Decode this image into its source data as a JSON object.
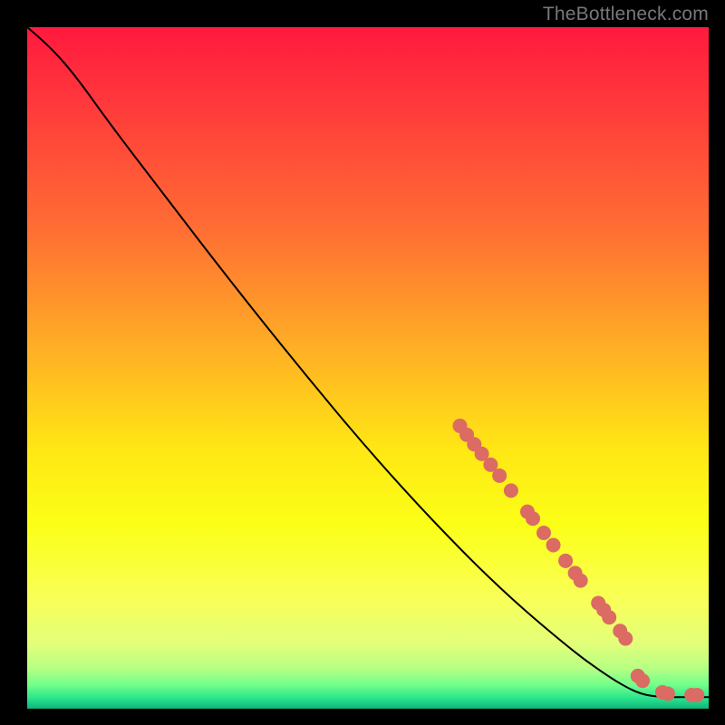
{
  "watermark": "TheBottleneck.com",
  "chart_data": {
    "type": "line",
    "title": "",
    "xlabel": "",
    "ylabel": "",
    "xlim": [
      0,
      100
    ],
    "ylim": [
      0,
      100
    ],
    "background_gradient": {
      "stops": [
        {
          "offset": 0.0,
          "color": "#ff193e"
        },
        {
          "offset": 0.12,
          "color": "#ff3b3b"
        },
        {
          "offset": 0.3,
          "color": "#ff6f33"
        },
        {
          "offset": 0.48,
          "color": "#ffb224"
        },
        {
          "offset": 0.62,
          "color": "#ffe714"
        },
        {
          "offset": 0.73,
          "color": "#fbff17"
        },
        {
          "offset": 0.84,
          "color": "#f9ff58"
        },
        {
          "offset": 0.905,
          "color": "#e2ff7a"
        },
        {
          "offset": 0.94,
          "color": "#b8ff83"
        },
        {
          "offset": 0.965,
          "color": "#72ff8b"
        },
        {
          "offset": 0.985,
          "color": "#29e48c"
        },
        {
          "offset": 1.0,
          "color": "#0fb37a"
        }
      ]
    },
    "series": [
      {
        "name": "curve",
        "color": "#000000",
        "width": 2,
        "points": [
          {
            "x": 0.0,
            "y": 100.0
          },
          {
            "x": 3.0,
            "y": 97.5
          },
          {
            "x": 7.0,
            "y": 93.0
          },
          {
            "x": 12.0,
            "y": 86.0
          },
          {
            "x": 20.0,
            "y": 75.5
          },
          {
            "x": 30.0,
            "y": 62.5
          },
          {
            "x": 40.0,
            "y": 50.0
          },
          {
            "x": 50.0,
            "y": 38.0
          },
          {
            "x": 60.0,
            "y": 27.0
          },
          {
            "x": 70.0,
            "y": 17.0
          },
          {
            "x": 80.0,
            "y": 8.5
          },
          {
            "x": 85.0,
            "y": 4.9
          },
          {
            "x": 88.0,
            "y": 3.1
          },
          {
            "x": 90.0,
            "y": 2.2
          },
          {
            "x": 92.0,
            "y": 1.8
          },
          {
            "x": 94.0,
            "y": 1.7
          },
          {
            "x": 97.0,
            "y": 1.7
          },
          {
            "x": 100.0,
            "y": 1.7
          }
        ]
      }
    ],
    "markers": {
      "name": "data-points",
      "color": "#db6b63",
      "radius": 8,
      "points": [
        {
          "x": 63.5,
          "y": 41.5
        },
        {
          "x": 64.5,
          "y": 40.2
        },
        {
          "x": 65.6,
          "y": 38.8
        },
        {
          "x": 66.7,
          "y": 37.4
        },
        {
          "x": 68.0,
          "y": 35.8
        },
        {
          "x": 69.3,
          "y": 34.2
        },
        {
          "x": 71.0,
          "y": 32.0
        },
        {
          "x": 73.4,
          "y": 28.9
        },
        {
          "x": 74.2,
          "y": 27.9
        },
        {
          "x": 75.8,
          "y": 25.8
        },
        {
          "x": 77.2,
          "y": 24.0
        },
        {
          "x": 79.0,
          "y": 21.7
        },
        {
          "x": 80.4,
          "y": 19.9
        },
        {
          "x": 81.2,
          "y": 18.8
        },
        {
          "x": 83.8,
          "y": 15.5
        },
        {
          "x": 84.6,
          "y": 14.5
        },
        {
          "x": 85.4,
          "y": 13.4
        },
        {
          "x": 87.0,
          "y": 11.4
        },
        {
          "x": 87.8,
          "y": 10.3
        },
        {
          "x": 89.6,
          "y": 4.8
        },
        {
          "x": 90.3,
          "y": 4.1
        },
        {
          "x": 93.2,
          "y": 2.4
        },
        {
          "x": 94.0,
          "y": 2.2
        },
        {
          "x": 97.5,
          "y": 2.0
        },
        {
          "x": 98.3,
          "y": 2.0
        }
      ]
    }
  }
}
